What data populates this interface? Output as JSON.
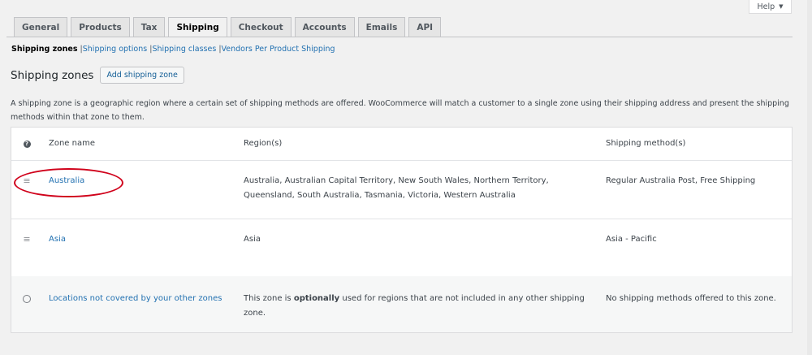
{
  "help": {
    "label": "Help",
    "caret": "▼"
  },
  "tabs": [
    {
      "label": "General",
      "active": false
    },
    {
      "label": "Products",
      "active": false
    },
    {
      "label": "Tax",
      "active": false
    },
    {
      "label": "Shipping",
      "active": true
    },
    {
      "label": "Checkout",
      "active": false
    },
    {
      "label": "Accounts",
      "active": false
    },
    {
      "label": "Emails",
      "active": false
    },
    {
      "label": "API",
      "active": false
    }
  ],
  "subnav": {
    "current": "Shipping zones",
    "links": [
      "Shipping options",
      "Shipping classes",
      "Vendors Per Product Shipping"
    ],
    "separator": "|"
  },
  "page": {
    "title": "Shipping zones",
    "add_button": "Add shipping zone",
    "description": "A shipping zone is a geographic region where a certain set of shipping methods are offered. WooCommerce will match a customer to a single zone using their shipping address and present the shipping methods within that zone to them."
  },
  "table": {
    "headers": {
      "icon": "?",
      "name": "Zone name",
      "region": "Region(s)",
      "method": "Shipping method(s)"
    },
    "rows": [
      {
        "icon": "drag-handle-icon",
        "name": "Australia",
        "region": "Australia, Australian Capital Territory, New South Wales, Northern Territory, Queensland, South Australia, Tasmania, Victoria, Western Australia",
        "method": "Regular Australia Post, Free Shipping"
      },
      {
        "icon": "drag-handle-icon",
        "name": "Asia",
        "region": "Asia",
        "method": "Asia - Pacific"
      }
    ],
    "fallback": {
      "icon": "globe-icon",
      "name": "Locations not covered by your other zones",
      "region_prefix": "This zone is ",
      "region_emphasis": "optionally",
      "region_suffix": " used for regions that are not included in any other shipping zone.",
      "method": "No shipping methods offered to this zone."
    }
  },
  "colors": {
    "accent": "#2271b1",
    "annotation": "#d0021b"
  }
}
